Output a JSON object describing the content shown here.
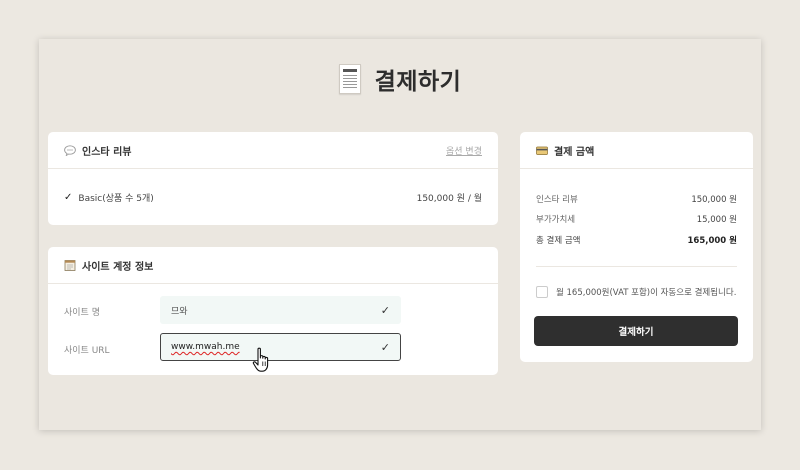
{
  "page": {
    "title": "결제하기",
    "title_icon": "receipt-icon"
  },
  "product_card": {
    "title": "인스타 리뷰",
    "icon": "speech-bubble-icon",
    "option_link": "옵션 변경",
    "item_name": "Basic(상품 수 5개)",
    "item_price": "150,000 원 / 월"
  },
  "account_card": {
    "title": "사이트 계정 정보",
    "icon": "notepad-icon",
    "site_name_label": "사이트 명",
    "site_name_value": "므와",
    "site_url_label": "사이트 URL",
    "site_url_value": "www.mwah.me"
  },
  "payment_card": {
    "title": "결제 금액",
    "icon": "credit-card-icon",
    "rows": [
      {
        "label": "인스타 리뷰",
        "value": "150,000 원"
      },
      {
        "label": "부가가치세",
        "value": "15,000 원"
      },
      {
        "label": "총 결제 금액",
        "value": "165,000 원"
      }
    ],
    "agree_text": "월 165,000원(VAT 포함)이 자동으로 결제됩니다.",
    "pay_button": "결제하기"
  }
}
